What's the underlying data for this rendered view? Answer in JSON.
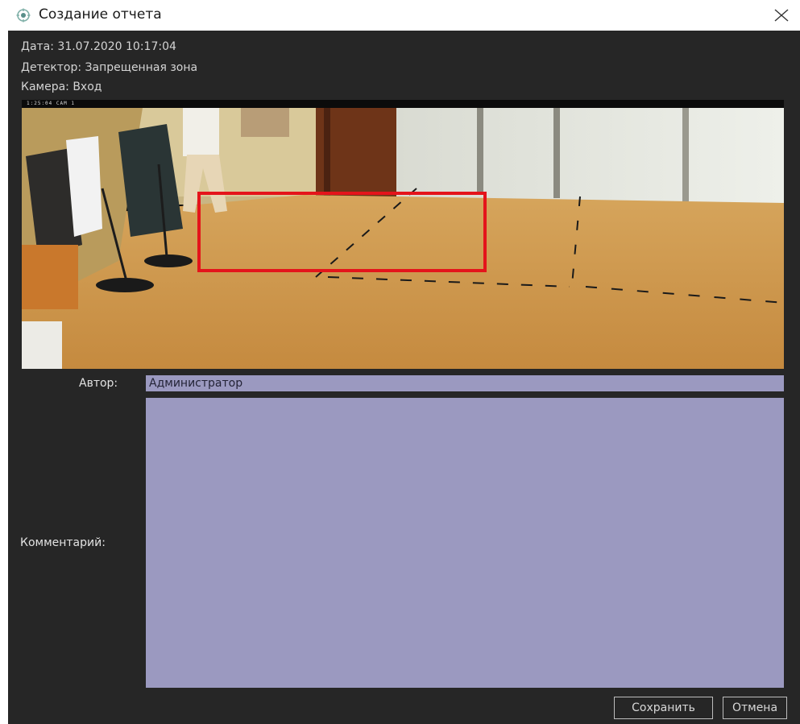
{
  "window": {
    "title": "Создание отчета",
    "icon": "app-logo-icon",
    "close_icon": "close-icon"
  },
  "info": {
    "date": "Дата: 31.07.2020 10:17:04",
    "detector": "Детектор: Запрещенная зона",
    "camera": "Камера: Вход"
  },
  "video": {
    "timestamp_overlay": "1:25:04 CAM 1",
    "detection_box_color": "#e4141b"
  },
  "form": {
    "author_label": "Автор:",
    "author_value": "Администратор",
    "comment_label": "Комментарий:",
    "comment_value": ""
  },
  "buttons": {
    "save": "Сохранить",
    "cancel": "Отмена"
  },
  "colors": {
    "dialog_bg": "#262626",
    "field_bg": "#9b99c0",
    "text": "#d4d4d4"
  }
}
